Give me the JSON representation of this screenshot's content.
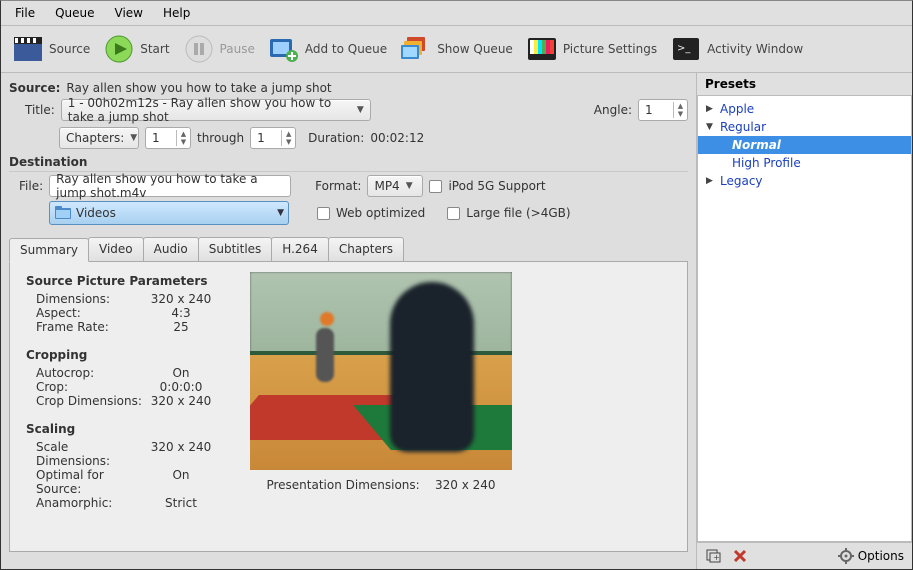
{
  "menubar": {
    "file": "File",
    "queue": "Queue",
    "view": "View",
    "help": "Help"
  },
  "toolbar": {
    "source": "Source",
    "start": "Start",
    "pause": "Pause",
    "addQueue": "Add to Queue",
    "showQueue": "Show Queue",
    "pictureSettings": "Picture Settings",
    "activity": "Activity Window"
  },
  "source": {
    "label": "Source:",
    "value": "Ray allen show you how to take a jump shot"
  },
  "title": {
    "label": "Title:",
    "value": "1 - 00h02m12s - Ray allen show you how to take a jump shot"
  },
  "angle": {
    "label": "Angle:",
    "value": "1"
  },
  "chapters": {
    "mode": "Chapters:",
    "start": "1",
    "through": "through",
    "end": "1",
    "durationLabel": "Duration:",
    "duration": "00:02:12"
  },
  "destination": {
    "heading": "Destination",
    "fileLabel": "File:",
    "file": "Ray allen show you how to take a jump shot.m4v",
    "formatLabel": "Format:",
    "format": "MP4",
    "ipod": "iPod 5G Support",
    "folder": "Videos",
    "webopt": "Web optimized",
    "largefile": "Large file (>4GB)"
  },
  "tabs": [
    "Summary",
    "Video",
    "Audio",
    "Subtitles",
    "H.264",
    "Chapters"
  ],
  "summary": {
    "srcHeading": "Source Picture Parameters",
    "dimensions": {
      "k": "Dimensions:",
      "v": "320 x 240"
    },
    "aspect": {
      "k": "Aspect:",
      "v": "4:3"
    },
    "framerate": {
      "k": "Frame Rate:",
      "v": "25"
    },
    "cropHeading": "Cropping",
    "autocrop": {
      "k": "Autocrop:",
      "v": "On"
    },
    "crop": {
      "k": "Crop:",
      "v": "0:0:0:0"
    },
    "cropdim": {
      "k": "Crop Dimensions:",
      "v": "320 x 240"
    },
    "scaleHeading": "Scaling",
    "scaledim": {
      "k": "Scale Dimensions:",
      "v": "320 x 240"
    },
    "optimal": {
      "k": "Optimal for Source:",
      "v": "On"
    },
    "anamorphic": {
      "k": "Anamorphic:",
      "v": "Strict"
    },
    "presDimLabel": "Presentation Dimensions:",
    "presDimValue": "320 x 240"
  },
  "presets": {
    "heading": "Presets",
    "apple": "Apple",
    "regular": "Regular",
    "normal": "Normal",
    "highProfile": "High Profile",
    "legacy": "Legacy",
    "options": "Options"
  }
}
